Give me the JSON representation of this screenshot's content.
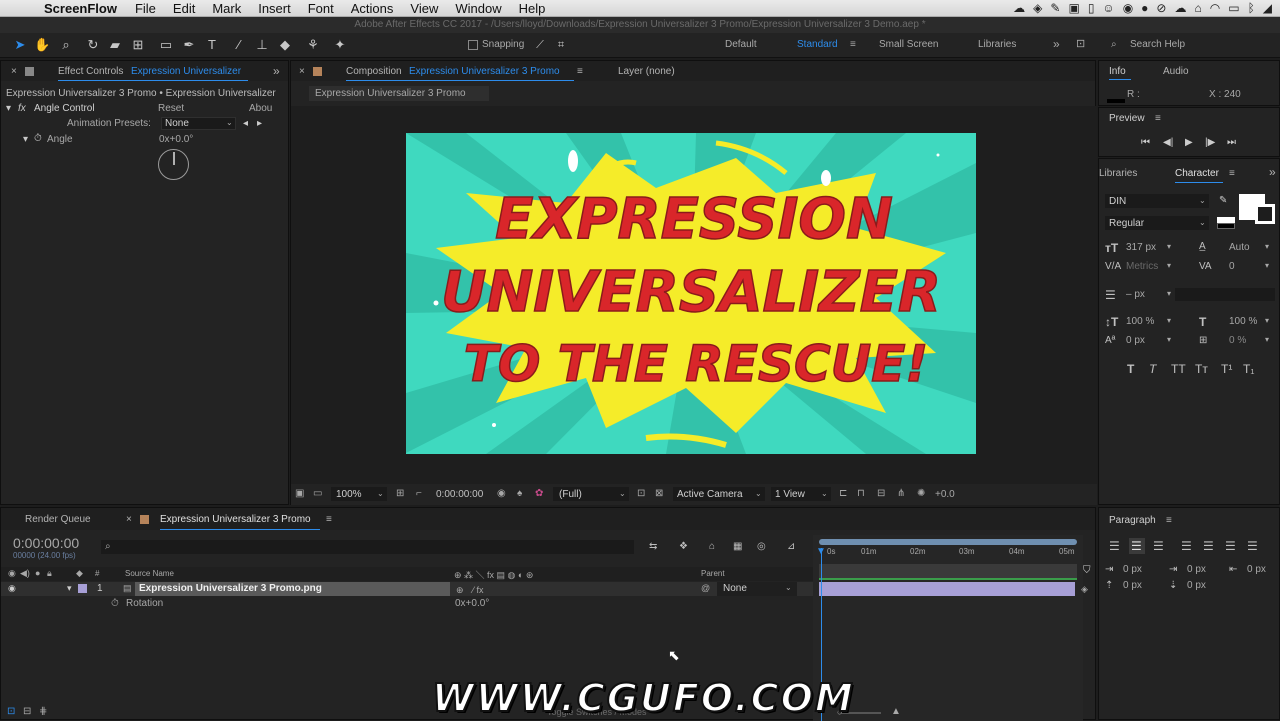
{
  "menubar": {
    "app": "ScreenFlow",
    "items": [
      "File",
      "Edit",
      "Mark",
      "Insert",
      "Font",
      "Actions",
      "View",
      "Window",
      "Help"
    ]
  },
  "window_title": "Adobe After Effects CC 2017 - /Users/lloyd/Downloads/Expression Universalizer 3 Promo/Expression Universalizer 3 Demo.aep *",
  "toolbar": {
    "snapping": "Snapping",
    "workspaces": [
      "Default",
      "Standard",
      "Small Screen",
      "Libraries"
    ],
    "active_workspace": "Standard",
    "search_placeholder": "Search Help"
  },
  "effect_controls": {
    "tab_prefix": "Effect Controls",
    "tab_layer": "Expression Universalizer",
    "breadcrumb": "Expression Universalizer 3 Promo • Expression Universalizer",
    "effect_name": "Angle Control",
    "reset": "Reset",
    "about": "Abou",
    "presets_label": "Animation Presets:",
    "presets_value": "None",
    "property": "Angle",
    "value": "0x+0.0°"
  },
  "composition": {
    "tab_prefix": "Composition",
    "tab_name": "Expression Universalizer 3 Promo",
    "layer_tab": "Layer (none)",
    "subtab": "Expression Universalizer 3 Promo",
    "art_lines": [
      "EXPRESSION",
      "UNIVERSALIZER",
      "TO THE RESCUE!"
    ],
    "footer": {
      "zoom": "100%",
      "timecode": "0:00:00:00",
      "resolution": "(Full)",
      "camera": "Active Camera",
      "views": "1 View",
      "exposure": "+0.0"
    },
    "colors": {
      "bg": "#3fd9bf",
      "burst": "#f5ec29",
      "text": "#d9262a"
    }
  },
  "info": {
    "tabs": [
      "Info",
      "Audio"
    ],
    "r": "R :",
    "x": "X : 240"
  },
  "preview": {
    "title": "Preview"
  },
  "character": {
    "tabs": [
      "Libraries",
      "Character"
    ],
    "font": "DIN",
    "style": "Regular",
    "size": "317 px",
    "leading": "Auto",
    "kerning": "Metrics",
    "tracking": "0",
    "stroke": "– px",
    "vscale": "100 %",
    "hscale": "100 %",
    "baseline": "0 px",
    "tsume": "0 %"
  },
  "paragraph": {
    "title": "Paragraph",
    "indent_left": "0 px",
    "indent_first": "0 px",
    "indent_right": "0 px",
    "space_before": "0 px",
    "space_after": "0 px"
  },
  "timeline": {
    "tab_render": "Render Queue",
    "tab_comp": "Expression Universalizer 3 Promo",
    "timecode": "0:00:00:00",
    "fps": "00000 (24.00 fps)",
    "col_source": "Source Name",
    "col_parent": "Parent",
    "col_num": "#",
    "layer_num": "1",
    "layer_name": "Expression Universalizer 3 Promo.png",
    "parent": "None",
    "property": "Rotation",
    "property_value": "0x+0.0°",
    "ruler": [
      "0s",
      "01m",
      "02m",
      "03m",
      "04m",
      "05m"
    ],
    "footer": "Toggle Switches / Modes"
  },
  "watermark": "WWW.CGUFO.COM"
}
